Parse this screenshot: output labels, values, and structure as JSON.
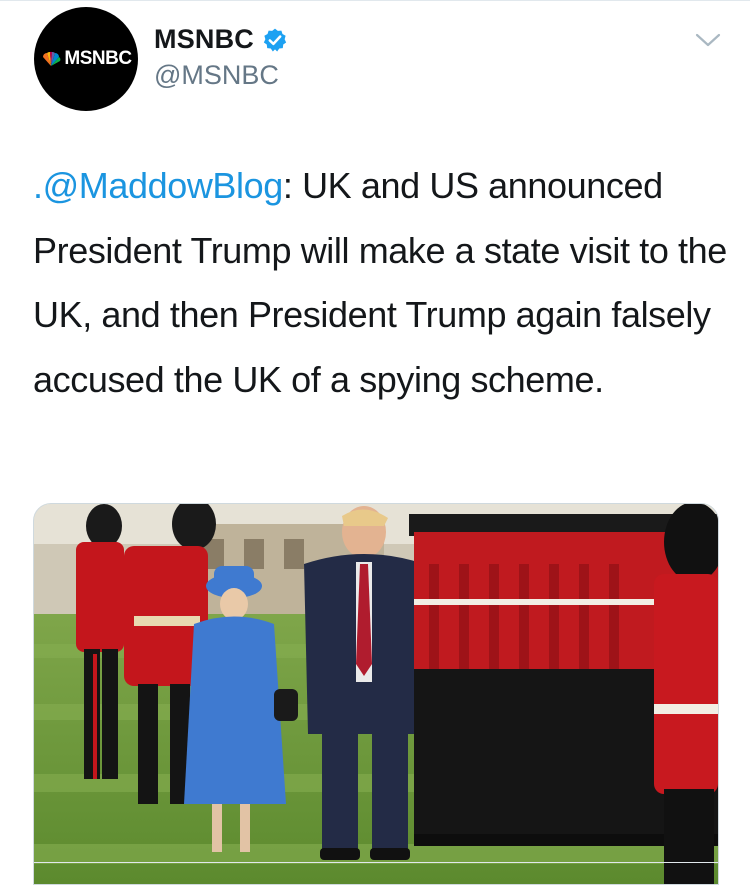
{
  "tweet": {
    "author": {
      "display_name": "MSNBC",
      "handle": "@MSNBC",
      "verified": true,
      "avatar_text": "MSNBC",
      "avatar_icon": "nbc-peacock-icon"
    },
    "text_mention": ".@MaddowBlog",
    "text_body": ": UK and US announced President Trump will make a state visit to the UK, and then President Trump again falsely accused the UK of a spying scheme.",
    "menu_icon": "chevron-down-icon",
    "media": {
      "type": "photo",
      "icon": "photo-image"
    }
  },
  "colors": {
    "text": "#14171a",
    "secondary": "#657786",
    "link": "#1b95e0",
    "verified": "#1da1f2"
  }
}
